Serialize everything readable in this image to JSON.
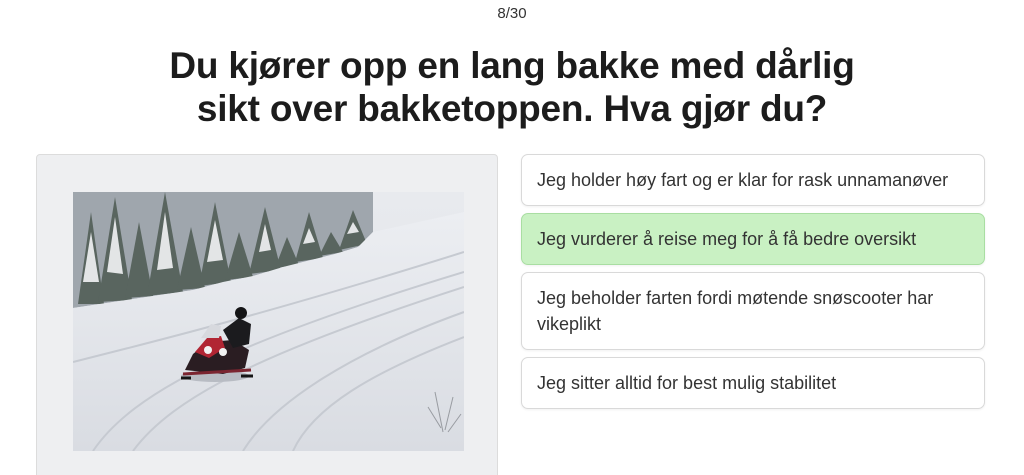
{
  "quiz": {
    "progress": "8/30",
    "question": "Du kjører opp en lang bakke med dårlig sikt over bakketoppen. Hva gjør du?"
  },
  "answers": [
    {
      "text": "Jeg holder høy fart og er klar for rask unnamanøver",
      "selected": false
    },
    {
      "text": "Jeg vurderer å reise meg for å få bedre oversikt",
      "selected": true
    },
    {
      "text": "Jeg beholder farten fordi møtende snøscooter har vikeplikt",
      "selected": false
    },
    {
      "text": "Jeg sitter alltid for best mulig stabilitet",
      "selected": false
    }
  ],
  "colors": {
    "selected_answer": "#c9f1c3",
    "image_panel": "#eeeff1"
  }
}
